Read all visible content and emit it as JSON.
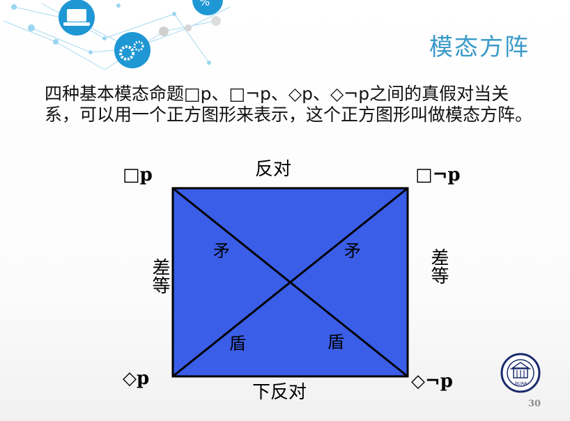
{
  "slide": {
    "title": "模态方阵",
    "intro": "四种基本模态命题□p、□¬p、◇p、◇¬p之间的真假对当关系，可以用一个正方图形来表示，这个正方图形叫做模态方阵。",
    "page_number": "30"
  },
  "square": {
    "corners": {
      "top_left": "□p",
      "top_right": "□¬p",
      "bottom_left": "◇p",
      "bottom_right": "◇¬p"
    },
    "edges": {
      "top": "反对",
      "bottom": "下反对",
      "left": "差等",
      "right": "差等"
    },
    "diagonal_labels": {
      "upper_left": "矛",
      "upper_right": "矛",
      "lower_left": "盾",
      "lower_right": "盾"
    },
    "fill_color": "#3a5ee8"
  },
  "logo": {
    "lettering": "NUAA",
    "name": "university-seal"
  }
}
